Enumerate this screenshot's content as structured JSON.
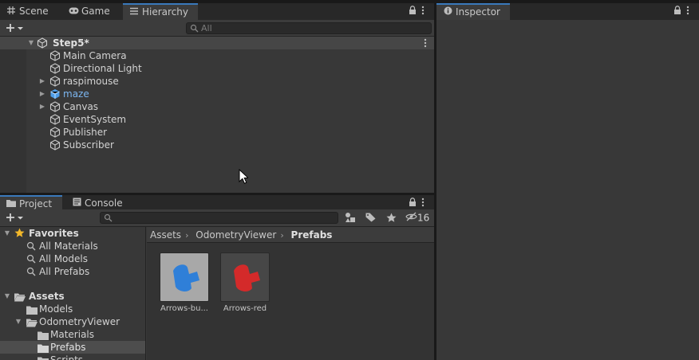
{
  "hierarchy": {
    "tabs": [
      {
        "label": "Scene",
        "icon": "grid-icon"
      },
      {
        "label": "Game",
        "icon": "gamepad-icon"
      },
      {
        "label": "Hierarchy",
        "icon": "list-icon",
        "active": true
      }
    ],
    "search_placeholder": "All",
    "scene_name": "Step5*",
    "items": [
      {
        "label": "Main Camera",
        "expandable": false
      },
      {
        "label": "Directional Light",
        "expandable": false
      },
      {
        "label": "raspimouse",
        "expandable": true
      },
      {
        "label": "maze",
        "expandable": true,
        "prefab": true
      },
      {
        "label": "Canvas",
        "expandable": true
      },
      {
        "label": "EventSystem",
        "expandable": false
      },
      {
        "label": "Publisher",
        "expandable": false
      },
      {
        "label": "Subscriber",
        "expandable": false
      }
    ]
  },
  "inspector": {
    "tab_label": "Inspector"
  },
  "project": {
    "tabs": [
      {
        "label": "Project",
        "icon": "folder-icon",
        "active": true
      },
      {
        "label": "Console",
        "icon": "console-icon"
      }
    ],
    "hidden_count": "16",
    "favorites": {
      "label": "Favorites",
      "items": [
        "All Materials",
        "All Models",
        "All Prefabs"
      ]
    },
    "assets": {
      "label": "Assets",
      "children": [
        {
          "label": "Models",
          "depth": 1
        },
        {
          "label": "OdometryViewer",
          "depth": 1,
          "expanded": true
        },
        {
          "label": "Materials",
          "depth": 2
        },
        {
          "label": "Prefabs",
          "depth": 2,
          "selected": true
        },
        {
          "label": "Scripts",
          "depth": 2
        }
      ]
    },
    "breadcrumb": [
      "Assets",
      "OdometryViewer",
      "Prefabs"
    ],
    "files": [
      {
        "label": "Arrows-bu...",
        "color": "#2f7fd8",
        "selected": true
      },
      {
        "label": "Arrows-red",
        "color": "#d42a2a",
        "selected": false
      }
    ]
  },
  "colors": {
    "accent": "#3a79bb",
    "prefab_text": "#7cb6f0",
    "selected_row": "#4d4d4d"
  }
}
